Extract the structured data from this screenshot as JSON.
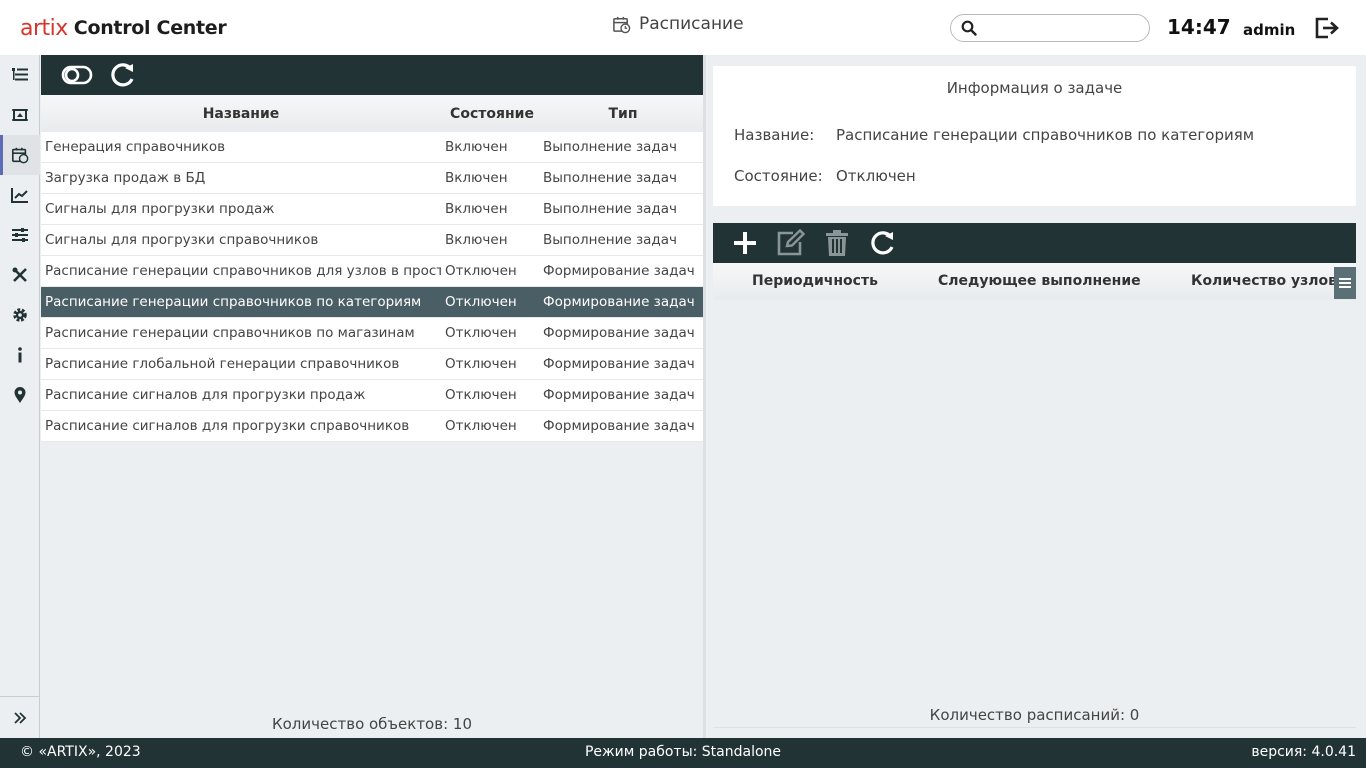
{
  "header": {
    "logo_brand": "artix",
    "logo_product": "Control Center",
    "page_title": "Расписание",
    "search_placeholder": "",
    "search_value": "",
    "time": "14:47",
    "user": "admin",
    "accent_color": "#d9342b"
  },
  "sidebar": {
    "items": [
      {
        "icon": "list-tree-icon",
        "active": false
      },
      {
        "icon": "frame-icon",
        "active": false
      },
      {
        "icon": "calendar-clock-icon",
        "active": true
      },
      {
        "icon": "chart-line-icon",
        "active": false
      },
      {
        "icon": "sliders-icon",
        "active": false
      },
      {
        "icon": "tools-icon",
        "active": false
      },
      {
        "icon": "gear-icon",
        "active": false
      },
      {
        "icon": "info-icon",
        "active": false
      },
      {
        "icon": "map-pin-icon",
        "active": false
      }
    ],
    "expand_icon": "double-chevron-right-icon"
  },
  "tasks": {
    "columns": {
      "name": "Название",
      "state": "Состояние",
      "type": "Тип"
    },
    "rows": [
      {
        "name": "Генерация справочников",
        "state": "Включен",
        "type": "Выполнение задач",
        "selected": false
      },
      {
        "name": "Загрузка продаж в БД",
        "state": "Включен",
        "type": "Выполнение задач",
        "selected": false
      },
      {
        "name": "Сигналы для прогрузки продаж",
        "state": "Включен",
        "type": "Выполнение задач",
        "selected": false
      },
      {
        "name": "Сигналы для прогрузки справочников",
        "state": "Включен",
        "type": "Выполнение задач",
        "selected": false
      },
      {
        "name": "Расписание генерации справочников для узлов в простое",
        "state": "Отключен",
        "type": "Формирование задач",
        "selected": false
      },
      {
        "name": "Расписание генерации справочников по категориям",
        "state": "Отключен",
        "type": "Формирование задач",
        "selected": true
      },
      {
        "name": "Расписание генерации справочников по магазинам",
        "state": "Отключен",
        "type": "Формирование задач",
        "selected": false
      },
      {
        "name": "Расписание глобальной генерации справочников",
        "state": "Отключен",
        "type": "Формирование задач",
        "selected": false
      },
      {
        "name": "Расписание сигналов для прогрузки продаж",
        "state": "Отключен",
        "type": "Формирование задач",
        "selected": false
      },
      {
        "name": "Расписание сигналов для прогрузки справочников",
        "state": "Отключен",
        "type": "Формирование задач",
        "selected": false
      }
    ],
    "count_label": "Количество объектов: 10"
  },
  "info": {
    "title": "Информация о задаче",
    "name_label": "Название:",
    "name_value": "Расписание генерации справочников по категориям",
    "state_label": "Состояние:",
    "state_value": "Отключен"
  },
  "schedules": {
    "columns": {
      "period": "Периодичность",
      "next": "Следующее выполнение",
      "nodes": "Количество узлов"
    },
    "rows": [],
    "count_label": "Количество расписаний: 0"
  },
  "footer": {
    "copyright": "© «ARTIX», 2023",
    "mode": "Режим работы: Standalone",
    "version": "версия: 4.0.41"
  }
}
